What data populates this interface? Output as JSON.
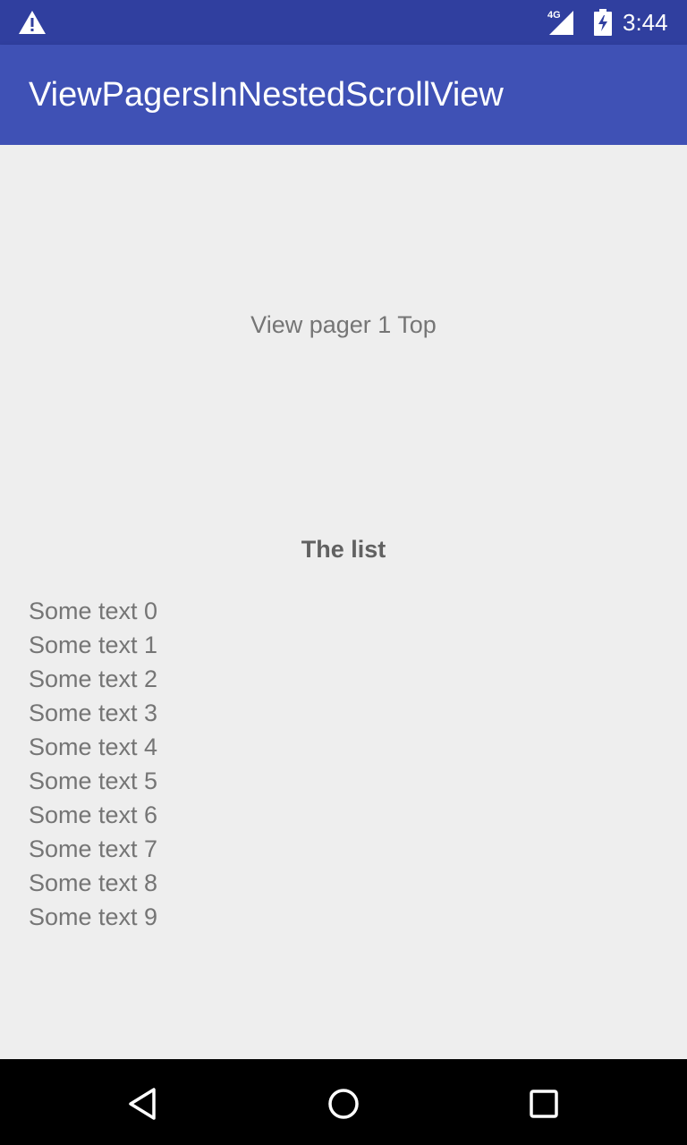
{
  "status_bar": {
    "time": "3:44",
    "network": "4G",
    "icons": [
      "warning-icon",
      "signal-icon",
      "battery-icon"
    ]
  },
  "app_bar": {
    "title": "ViewPagersInNestedScrollView",
    "color": "#3f51b5",
    "status_color": "#303f9f"
  },
  "pager": {
    "label": "View pager 1 Top"
  },
  "list": {
    "title": "The list",
    "items": [
      "Some text 0",
      "Some text 1",
      "Some text 2",
      "Some text 3",
      "Some text 4",
      "Some text 5",
      "Some text 6",
      "Some text 7",
      "Some text 8",
      "Some text 9"
    ]
  },
  "nav_bar": {
    "buttons": [
      "back-icon",
      "home-icon",
      "recent-apps-icon"
    ]
  }
}
